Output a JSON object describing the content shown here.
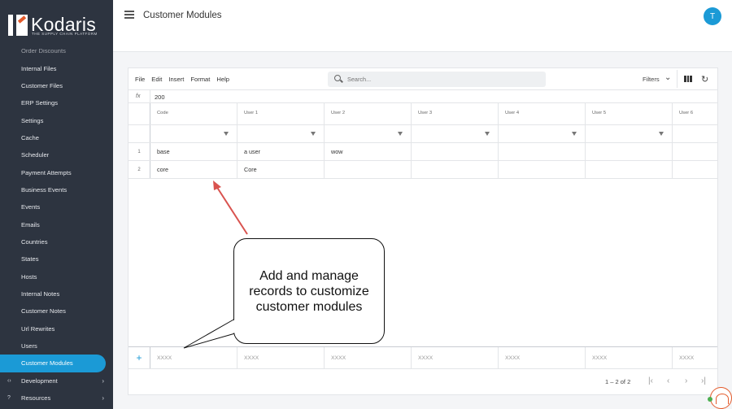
{
  "brand": {
    "name": "Kodaris",
    "tagline": "THE SUPPLY CHAIN PLATFORM"
  },
  "sidebar": {
    "items": [
      {
        "label": "Order Discounts"
      },
      {
        "label": "Internal Files"
      },
      {
        "label": "Customer Files"
      },
      {
        "label": "ERP Settings"
      },
      {
        "label": "Settings"
      },
      {
        "label": "Cache"
      },
      {
        "label": "Scheduler"
      },
      {
        "label": "Payment Attempts"
      },
      {
        "label": "Business Events"
      },
      {
        "label": "Events"
      },
      {
        "label": "Emails"
      },
      {
        "label": "Countries"
      },
      {
        "label": "States"
      },
      {
        "label": "Hosts"
      },
      {
        "label": "Internal Notes"
      },
      {
        "label": "Customer Notes"
      },
      {
        "label": "Url Rewrites"
      },
      {
        "label": "Users"
      },
      {
        "label": "Customer Modules"
      }
    ],
    "groups": [
      {
        "label": "Development"
      },
      {
        "label": "Resources"
      }
    ]
  },
  "header": {
    "title": "Customer Modules",
    "avatar_initial": "T"
  },
  "toolbar": {
    "menu": [
      "File",
      "Edit",
      "Insert",
      "Format",
      "Help"
    ],
    "search_placeholder": "Search...",
    "filters_label": "Filters"
  },
  "formula": {
    "fx": "fx",
    "value": "200"
  },
  "grid": {
    "columns": [
      "Code",
      "User 1",
      "User 2",
      "User 3",
      "User 4",
      "User 5",
      "User 6"
    ],
    "rows": [
      {
        "num": "1",
        "cells": [
          "base",
          "a user",
          "wow",
          "",
          "",
          "",
          ""
        ]
      },
      {
        "num": "2",
        "cells": [
          "core",
          "Core",
          "",
          "",
          "",
          "",
          ""
        ]
      }
    ],
    "new_row_placeholder": "XXXX",
    "add_icon": "+"
  },
  "pager": {
    "text": "1 – 2 of 2"
  },
  "callout": {
    "text": "Add and manage records to customize customer modules"
  },
  "colors": {
    "accent": "#1b9ad6",
    "sidebar": "#2d3440",
    "arrow": "#d9534f"
  }
}
